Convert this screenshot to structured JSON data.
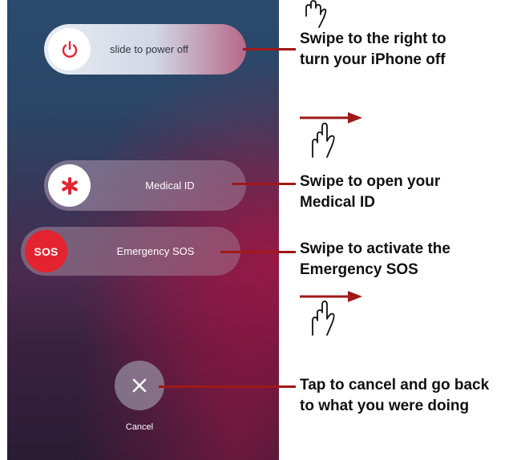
{
  "screen": {
    "power_slider": {
      "label": "slide to power off",
      "icon": "power-icon"
    },
    "medical_slider": {
      "label": "Medical ID",
      "icon": "asterisk-icon"
    },
    "sos_slider": {
      "label": "Emergency SOS",
      "knob_text": "SOS"
    },
    "cancel": {
      "label": "Cancel",
      "icon": "close-icon"
    }
  },
  "annotations": {
    "power": {
      "line1": "Swipe to the right to",
      "line2": "turn your iPhone off"
    },
    "medical": {
      "line1": "Swipe to open your",
      "line2": "Medical ID"
    },
    "sos": {
      "line1": "Swipe to activate the",
      "line2": "Emergency SOS"
    },
    "cancel": {
      "line1": "Tap to cancel and go back",
      "line2": "to what you were doing"
    }
  },
  "colors": {
    "callout_line": "#a01818",
    "sos_red": "#e3232f",
    "power_red": "#e3232f"
  }
}
